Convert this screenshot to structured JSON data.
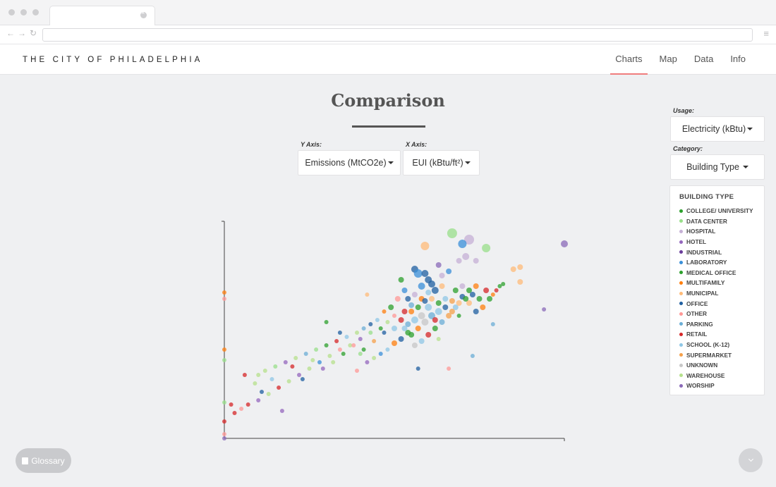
{
  "header": {
    "brand": "THE CITY OF PHILADELPHIA",
    "nav": [
      "Charts",
      "Map",
      "Data",
      "Info"
    ],
    "active_nav": "Charts"
  },
  "main": {
    "title": "Comparison",
    "y_axis": {
      "caption": "Y Axis:",
      "value": "Emissions (MtCO2e)"
    },
    "x_axis": {
      "caption": "X Axis:",
      "value": "EUI (kBtu/ft²)"
    }
  },
  "sidebar": {
    "usage": {
      "caption": "Usage:",
      "value": "Electricity (kBtu)"
    },
    "category": {
      "caption": "Category:",
      "value": "Building Type"
    },
    "legend_title": "BUILDING TYPE",
    "legend": [
      {
        "label": "COLLEGE/ UNIVERSITY",
        "color": "#2ca02c"
      },
      {
        "label": "DATA CENTER",
        "color": "#98df8a"
      },
      {
        "label": "HOSPITAL",
        "color": "#c5b0d5"
      },
      {
        "label": "HOTEL",
        "color": "#9467bd"
      },
      {
        "label": "INDUSTRIAL",
        "color": "#6a3d9a"
      },
      {
        "label": "LABORATORY",
        "color": "#3a8fd8"
      },
      {
        "label": "MEDICAL OFFICE",
        "color": "#2ca02c"
      },
      {
        "label": "MULTIFAMILY",
        "color": "#ff7f0e"
      },
      {
        "label": "MUNICIPAL",
        "color": "#ffbb78"
      },
      {
        "label": "OFFICE",
        "color": "#1f5fa0"
      },
      {
        "label": "OTHER",
        "color": "#ff9896"
      },
      {
        "label": "PARKING",
        "color": "#6baed6"
      },
      {
        "label": "RETAIL",
        "color": "#d62728"
      },
      {
        "label": "SCHOOL (K-12)",
        "color": "#8fc7e6"
      },
      {
        "label": "SUPERMARKET",
        "color": "#f5a04a"
      },
      {
        "label": "UNKNOWN",
        "color": "#c7c7c7"
      },
      {
        "label": "WAREHOUSE",
        "color": "#b5e08b"
      },
      {
        "label": "WORSHIP",
        "color": "#8a6ab8"
      }
    ]
  },
  "footer": {
    "glossary_label": "Glossary"
  },
  "chart_data": {
    "type": "scatter",
    "title": "",
    "xlabel": "",
    "ylabel": "",
    "grid": false,
    "points": [
      {
        "x": 0.67,
        "y": 0.97,
        "r": 7,
        "series": "DATA CENTER"
      },
      {
        "x": 0.59,
        "y": 0.91,
        "r": 6,
        "series": "MUNICIPAL"
      },
      {
        "x": 0.72,
        "y": 0.94,
        "r": 7,
        "series": "HOSPITAL"
      },
      {
        "x": 0.7,
        "y": 0.92,
        "r": 6,
        "series": "LABORATORY"
      },
      {
        "x": 0.77,
        "y": 0.9,
        "r": 6,
        "series": "DATA CENTER"
      },
      {
        "x": 1.0,
        "y": 0.92,
        "r": 5,
        "series": "WORSHIP"
      },
      {
        "x": 0.71,
        "y": 0.86,
        "r": 5,
        "series": "HOSPITAL"
      },
      {
        "x": 0.69,
        "y": 0.84,
        "r": 4,
        "series": "HOSPITAL"
      },
      {
        "x": 0.74,
        "y": 0.84,
        "r": 4,
        "series": "HOSPITAL"
      },
      {
        "x": 0.87,
        "y": 0.81,
        "r": 4,
        "series": "MUNICIPAL"
      },
      {
        "x": 0.85,
        "y": 0.8,
        "r": 4,
        "series": "MUNICIPAL"
      },
      {
        "x": 0.94,
        "y": 0.61,
        "r": 3,
        "series": "WORSHIP"
      },
      {
        "x": 0.87,
        "y": 0.74,
        "r": 4,
        "series": "MUNICIPAL"
      },
      {
        "x": 0.42,
        "y": 0.68,
        "r": 3,
        "series": "MUNICIPAL"
      },
      {
        "x": 0.56,
        "y": 0.8,
        "r": 5,
        "series": "OFFICE"
      },
      {
        "x": 0.57,
        "y": 0.78,
        "r": 6,
        "series": "LABORATORY"
      },
      {
        "x": 0.59,
        "y": 0.78,
        "r": 5,
        "series": "OFFICE"
      },
      {
        "x": 0.52,
        "y": 0.75,
        "r": 4,
        "series": "COLLEGE/ UNIVERSITY"
      },
      {
        "x": 0.63,
        "y": 0.82,
        "r": 4,
        "series": "WORSHIP"
      },
      {
        "x": 0.64,
        "y": 0.77,
        "r": 4,
        "series": "HOSPITAL"
      },
      {
        "x": 0.66,
        "y": 0.79,
        "r": 4,
        "series": "LABORATORY"
      },
      {
        "x": 0.61,
        "y": 0.73,
        "r": 5,
        "series": "OFFICE"
      },
      {
        "x": 0.6,
        "y": 0.69,
        "r": 4,
        "series": "SCHOOL (K-12)"
      },
      {
        "x": 0.58,
        "y": 0.66,
        "r": 4,
        "series": "MULTIFAMILY"
      },
      {
        "x": 0.55,
        "y": 0.63,
        "r": 4,
        "series": "PARKING"
      },
      {
        "x": 0.53,
        "y": 0.6,
        "r": 4,
        "series": "RETAIL"
      },
      {
        "x": 0.5,
        "y": 0.58,
        "r": 3,
        "series": "OTHER"
      },
      {
        "x": 0.48,
        "y": 0.55,
        "r": 3,
        "series": "WAREHOUSE"
      },
      {
        "x": 0.46,
        "y": 0.52,
        "r": 3,
        "series": "MEDICAL OFFICE"
      },
      {
        "x": 0.43,
        "y": 0.5,
        "r": 3,
        "series": "DATA CENTER"
      },
      {
        "x": 0.4,
        "y": 0.47,
        "r": 3,
        "series": "HOTEL"
      },
      {
        "x": 0.37,
        "y": 0.44,
        "r": 3,
        "series": "WAREHOUSE"
      },
      {
        "x": 0.34,
        "y": 0.42,
        "r": 3,
        "series": "OTHER"
      },
      {
        "x": 0.31,
        "y": 0.39,
        "r": 3,
        "series": "WAREHOUSE"
      },
      {
        "x": 0.28,
        "y": 0.36,
        "r": 3,
        "series": "LABORATORY"
      },
      {
        "x": 0.25,
        "y": 0.33,
        "r": 3,
        "series": "WAREHOUSE"
      },
      {
        "x": 0.22,
        "y": 0.3,
        "r": 3,
        "series": "HOTEL"
      },
      {
        "x": 0.19,
        "y": 0.27,
        "r": 3,
        "series": "WAREHOUSE"
      },
      {
        "x": 0.16,
        "y": 0.24,
        "r": 3,
        "series": "RETAIL"
      },
      {
        "x": 0.13,
        "y": 0.21,
        "r": 3,
        "series": "WAREHOUSE"
      },
      {
        "x": 0.1,
        "y": 0.18,
        "r": 3,
        "series": "HOTEL"
      },
      {
        "x": 0.07,
        "y": 0.16,
        "r": 3,
        "series": "RETAIL"
      },
      {
        "x": 0.05,
        "y": 0.14,
        "r": 3,
        "series": "OTHER"
      },
      {
        "x": 0.03,
        "y": 0.12,
        "r": 3,
        "series": "RETAIL"
      },
      {
        "x": 0.06,
        "y": 0.3,
        "r": 3,
        "series": "RETAIL"
      },
      {
        "x": 0.1,
        "y": 0.3,
        "r": 3,
        "series": "WAREHOUSE"
      },
      {
        "x": 0.17,
        "y": 0.13,
        "r": 3,
        "series": "HOTEL"
      },
      {
        "x": 0.3,
        "y": 0.55,
        "r": 3,
        "series": "MEDICAL OFFICE"
      },
      {
        "x": 0.34,
        "y": 0.5,
        "r": 3,
        "series": "OFFICE"
      },
      {
        "x": 0.39,
        "y": 0.32,
        "r": 3,
        "series": "OTHER"
      },
      {
        "x": 0.57,
        "y": 0.33,
        "r": 3,
        "series": "OFFICE"
      },
      {
        "x": 0.66,
        "y": 0.33,
        "r": 3,
        "series": "OTHER"
      },
      {
        "x": 0.73,
        "y": 0.39,
        "r": 3,
        "series": "PARKING"
      },
      {
        "x": 0.79,
        "y": 0.54,
        "r": 3,
        "series": "PARKING"
      },
      {
        "x": 0.82,
        "y": 0.73,
        "r": 3,
        "series": "MEDICAL OFFICE"
      },
      {
        "x": 0.8,
        "y": 0.7,
        "r": 3,
        "series": "RETAIL"
      },
      {
        "x": 0.78,
        "y": 0.66,
        "r": 4,
        "series": "COLLEGE/ UNIVERSITY"
      },
      {
        "x": 0.76,
        "y": 0.62,
        "r": 4,
        "series": "MULTIFAMILY"
      },
      {
        "x": 0.74,
        "y": 0.6,
        "r": 4,
        "series": "OFFICE"
      },
      {
        "x": 0.72,
        "y": 0.64,
        "r": 4,
        "series": "MUNICIPAL"
      },
      {
        "x": 0.7,
        "y": 0.67,
        "r": 4,
        "series": "OFFICE"
      },
      {
        "x": 0.68,
        "y": 0.62,
        "r": 4,
        "series": "SCHOOL (K-12)"
      },
      {
        "x": 0.66,
        "y": 0.58,
        "r": 4,
        "series": "SUPERMARKET"
      },
      {
        "x": 0.64,
        "y": 0.55,
        "r": 4,
        "series": "PARKING"
      },
      {
        "x": 0.62,
        "y": 0.52,
        "r": 4,
        "series": "COLLEGE/ UNIVERSITY"
      },
      {
        "x": 0.6,
        "y": 0.49,
        "r": 4,
        "series": "RETAIL"
      },
      {
        "x": 0.58,
        "y": 0.46,
        "r": 4,
        "series": "SCHOOL (K-12)"
      },
      {
        "x": 0.56,
        "y": 0.44,
        "r": 4,
        "series": "UNKNOWN"
      },
      {
        "x": 0.54,
        "y": 0.5,
        "r": 4,
        "series": "MEDICAL OFFICE"
      },
      {
        "x": 0.52,
        "y": 0.47,
        "r": 4,
        "series": "OFFICE"
      },
      {
        "x": 0.5,
        "y": 0.45,
        "r": 4,
        "series": "MULTIFAMILY"
      },
      {
        "x": 0.48,
        "y": 0.42,
        "r": 3,
        "series": "SCHOOL (K-12)"
      },
      {
        "x": 0.46,
        "y": 0.4,
        "r": 3,
        "series": "LABORATORY"
      },
      {
        "x": 0.44,
        "y": 0.38,
        "r": 3,
        "series": "WAREHOUSE"
      },
      {
        "x": 0.42,
        "y": 0.36,
        "r": 3,
        "series": "HOTEL"
      },
      {
        "x": 0.4,
        "y": 0.4,
        "r": 3,
        "series": "DATA CENTER"
      },
      {
        "x": 0.62,
        "y": 0.7,
        "r": 5,
        "series": "OFFICE"
      },
      {
        "x": 0.64,
        "y": 0.72,
        "r": 4,
        "series": "MUNICIPAL"
      },
      {
        "x": 0.68,
        "y": 0.7,
        "r": 4,
        "series": "COLLEGE/ UNIVERSITY"
      },
      {
        "x": 0.7,
        "y": 0.72,
        "r": 4,
        "series": "HOSPITAL"
      },
      {
        "x": 0.72,
        "y": 0.7,
        "r": 4,
        "series": "MEDICAL OFFICE"
      },
      {
        "x": 0.74,
        "y": 0.72,
        "r": 4,
        "series": "MULTIFAMILY"
      },
      {
        "x": 0.6,
        "y": 0.62,
        "r": 5,
        "series": "SCHOOL (K-12)"
      },
      {
        "x": 0.58,
        "y": 0.58,
        "r": 5,
        "series": "UNKNOWN"
      },
      {
        "x": 0.56,
        "y": 0.56,
        "r": 5,
        "series": "SCHOOL (K-12)"
      },
      {
        "x": 0.54,
        "y": 0.54,
        "r": 4,
        "series": "PARKING"
      },
      {
        "x": 0.53,
        "y": 0.7,
        "r": 4,
        "series": "LABORATORY"
      },
      {
        "x": 0.51,
        "y": 0.66,
        "r": 4,
        "series": "OTHER"
      },
      {
        "x": 0.49,
        "y": 0.62,
        "r": 4,
        "series": "COLLEGE/ UNIVERSITY"
      },
      {
        "x": 0.47,
        "y": 0.6,
        "r": 3,
        "series": "MULTIFAMILY"
      },
      {
        "x": 0.45,
        "y": 0.56,
        "r": 3,
        "series": "SCHOOL (K-12)"
      },
      {
        "x": 0.43,
        "y": 0.54,
        "r": 3,
        "series": "OFFICE"
      },
      {
        "x": 0.41,
        "y": 0.52,
        "r": 3,
        "series": "PARKING"
      },
      {
        "x": 0.39,
        "y": 0.5,
        "r": 3,
        "series": "WAREHOUSE"
      },
      {
        "x": 0.36,
        "y": 0.48,
        "r": 3,
        "series": "SCHOOL (K-12)"
      },
      {
        "x": 0.33,
        "y": 0.46,
        "r": 3,
        "series": "RETAIL"
      },
      {
        "x": 0.3,
        "y": 0.44,
        "r": 3,
        "series": "MEDICAL OFFICE"
      },
      {
        "x": 0.27,
        "y": 0.42,
        "r": 3,
        "series": "DATA CENTER"
      },
      {
        "x": 0.24,
        "y": 0.4,
        "r": 3,
        "series": "PARKING"
      },
      {
        "x": 0.21,
        "y": 0.38,
        "r": 3,
        "series": "WAREHOUSE"
      },
      {
        "x": 0.18,
        "y": 0.36,
        "r": 3,
        "series": "HOTEL"
      },
      {
        "x": 0.15,
        "y": 0.34,
        "r": 3,
        "series": "DATA CENTER"
      },
      {
        "x": 0.12,
        "y": 0.32,
        "r": 3,
        "series": "WAREHOUSE"
      },
      {
        "x": 0.09,
        "y": 0.26,
        "r": 3,
        "series": "WAREHOUSE"
      },
      {
        "x": 0.11,
        "y": 0.22,
        "r": 3,
        "series": "OFFICE"
      },
      {
        "x": 0.14,
        "y": 0.28,
        "r": 3,
        "series": "SCHOOL (K-12)"
      },
      {
        "x": 0.2,
        "y": 0.34,
        "r": 3,
        "series": "RETAIL"
      },
      {
        "x": 0.23,
        "y": 0.28,
        "r": 3,
        "series": "OFFICE"
      },
      {
        "x": 0.26,
        "y": 0.37,
        "r": 3,
        "series": "WAREHOUSE"
      },
      {
        "x": 0.29,
        "y": 0.33,
        "r": 3,
        "series": "HOTEL"
      },
      {
        "x": 0.32,
        "y": 0.36,
        "r": 3,
        "series": "WAREHOUSE"
      },
      {
        "x": 0.35,
        "y": 0.4,
        "r": 3,
        "series": "COLLEGE/ UNIVERSITY"
      },
      {
        "x": 0.38,
        "y": 0.44,
        "r": 3,
        "series": "OTHER"
      },
      {
        "x": 0.41,
        "y": 0.42,
        "r": 3,
        "series": "MEDICAL OFFICE"
      },
      {
        "x": 0.44,
        "y": 0.46,
        "r": 3,
        "series": "SUPERMARKET"
      },
      {
        "x": 0.47,
        "y": 0.5,
        "r": 3,
        "series": "OFFICE"
      },
      {
        "x": 0.5,
        "y": 0.52,
        "r": 4,
        "series": "SCHOOL (K-12)"
      },
      {
        "x": 0.52,
        "y": 0.56,
        "r": 4,
        "series": "RETAIL"
      },
      {
        "x": 0.55,
        "y": 0.6,
        "r": 4,
        "series": "MULTIFAMILY"
      },
      {
        "x": 0.57,
        "y": 0.62,
        "r": 4,
        "series": "COLLEGE/ UNIVERSITY"
      },
      {
        "x": 0.59,
        "y": 0.65,
        "r": 4,
        "series": "OFFICE"
      },
      {
        "x": 0.61,
        "y": 0.66,
        "r": 4,
        "series": "MUNICIPAL"
      },
      {
        "x": 0.63,
        "y": 0.64,
        "r": 4,
        "series": "MEDICAL OFFICE"
      },
      {
        "x": 0.65,
        "y": 0.66,
        "r": 4,
        "series": "SCHOOL (K-12)"
      },
      {
        "x": 0.67,
        "y": 0.65,
        "r": 4,
        "series": "SUPERMARKET"
      },
      {
        "x": 0.69,
        "y": 0.64,
        "r": 4,
        "series": "MUNICIPAL"
      },
      {
        "x": 0.71,
        "y": 0.66,
        "r": 4,
        "series": "COLLEGE/ UNIVERSITY"
      },
      {
        "x": 0.73,
        "y": 0.68,
        "r": 4,
        "series": "OFFICE"
      },
      {
        "x": 0.75,
        "y": 0.66,
        "r": 4,
        "series": "MEDICAL OFFICE"
      },
      {
        "x": 0.77,
        "y": 0.7,
        "r": 4,
        "series": "RETAIL"
      },
      {
        "x": 0.79,
        "y": 0.68,
        "r": 3,
        "series": "MULTIFAMILY"
      },
      {
        "x": 0.81,
        "y": 0.72,
        "r": 3,
        "series": "COLLEGE/ UNIVERSITY"
      },
      {
        "x": 0.58,
        "y": 0.72,
        "r": 5,
        "series": "LABORATORY"
      },
      {
        "x": 0.6,
        "y": 0.75,
        "r": 5,
        "series": "OFFICE"
      },
      {
        "x": 0.56,
        "y": 0.68,
        "r": 4,
        "series": "HOSPITAL"
      },
      {
        "x": 0.54,
        "y": 0.66,
        "r": 4,
        "series": "OFFICE"
      },
      {
        "x": 0.63,
        "y": 0.6,
        "r": 5,
        "series": "SCHOOL (K-12)"
      },
      {
        "x": 0.61,
        "y": 0.58,
        "r": 5,
        "series": "PARKING"
      },
      {
        "x": 0.59,
        "y": 0.55,
        "r": 5,
        "series": "UNKNOWN"
      },
      {
        "x": 0.57,
        "y": 0.52,
        "r": 4,
        "series": "MULTIFAMILY"
      },
      {
        "x": 0.55,
        "y": 0.49,
        "r": 4,
        "series": "MEDICAL OFFICE"
      },
      {
        "x": 0.53,
        "y": 0.52,
        "r": 4,
        "series": "SCHOOL (K-12)"
      },
      {
        "x": 0.65,
        "y": 0.62,
        "r": 4,
        "series": "OFFICE"
      },
      {
        "x": 0.67,
        "y": 0.6,
        "r": 4,
        "series": "SUPERMARKET"
      },
      {
        "x": 0.69,
        "y": 0.58,
        "r": 3,
        "series": "MEDICAL OFFICE"
      },
      {
        "x": 0.62,
        "y": 0.56,
        "r": 4,
        "series": "RETAIL"
      },
      {
        "x": 0.63,
        "y": 0.47,
        "r": 3,
        "series": "WAREHOUSE"
      },
      {
        "x": 0.0,
        "y": 0.69,
        "r": 3,
        "series": "MULTIFAMILY"
      },
      {
        "x": 0.0,
        "y": 0.66,
        "r": 3,
        "series": "OTHER"
      },
      {
        "x": 0.0,
        "y": 0.42,
        "r": 3,
        "series": "MULTIFAMILY"
      },
      {
        "x": 0.0,
        "y": 0.37,
        "r": 3,
        "series": "DATA CENTER"
      },
      {
        "x": 0.0,
        "y": 0.17,
        "r": 3,
        "series": "DATA CENTER"
      },
      {
        "x": 0.0,
        "y": 0.08,
        "r": 3,
        "series": "RETAIL"
      },
      {
        "x": 0.0,
        "y": 0.02,
        "r": 3,
        "series": "OTHER"
      },
      {
        "x": 0.0,
        "y": 0.0,
        "r": 3,
        "series": "WORSHIP"
      },
      {
        "x": 0.02,
        "y": 0.16,
        "r": 3,
        "series": "RETAIL"
      }
    ]
  }
}
